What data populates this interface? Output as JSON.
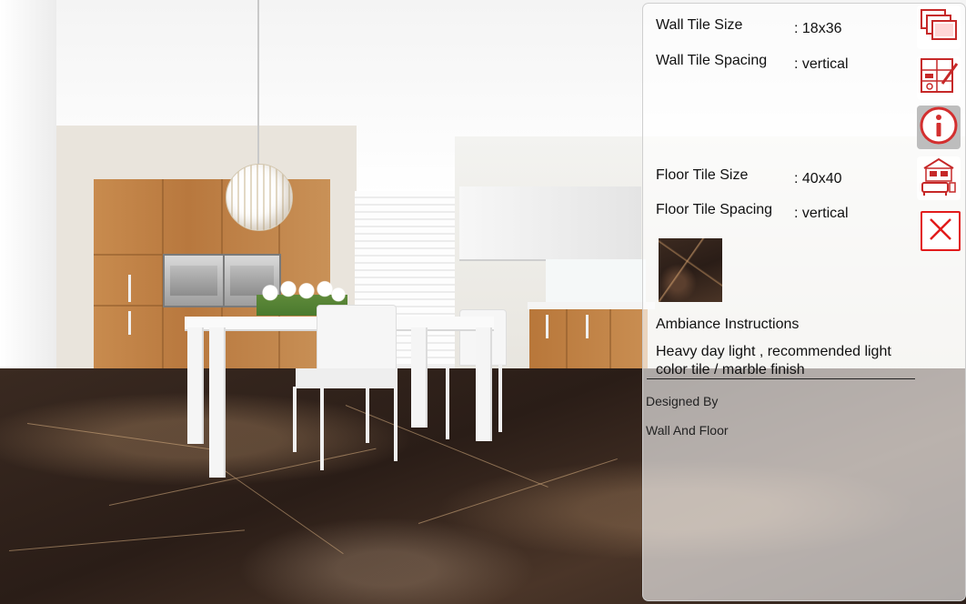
{
  "panel": {
    "wall_tile_size_label": "Wall Tile Size",
    "wall_tile_size_value": ": 18x36",
    "wall_tile_spacing_label": "Wall Tile Spacing",
    "wall_tile_spacing_value": ": vertical",
    "floor_tile_size_label": "Floor Tile Size",
    "floor_tile_size_value": ": 40x40",
    "floor_tile_spacing_label": "Floor Tile Spacing",
    "floor_tile_spacing_value": ": vertical",
    "ambiance_heading": "Ambiance Instructions",
    "ambiance_text": "Heavy day light , recommended light color tile / marble finish",
    "designed_by_label": "Designed By",
    "designed_by_value": "Wall And Floor"
  },
  "icons": [
    {
      "name": "tile-layers-icon",
      "active": false
    },
    {
      "name": "tile-layout-edit-icon",
      "active": false
    },
    {
      "name": "info-icon",
      "active": true
    },
    {
      "name": "room-scene-icon",
      "active": false
    },
    {
      "name": "close-icon",
      "active": false
    }
  ],
  "colors": {
    "accent": "#e21b1b",
    "active_button_bg": "#bdbdbd",
    "panel_bg": "rgba(255,255,255,0.62)"
  }
}
